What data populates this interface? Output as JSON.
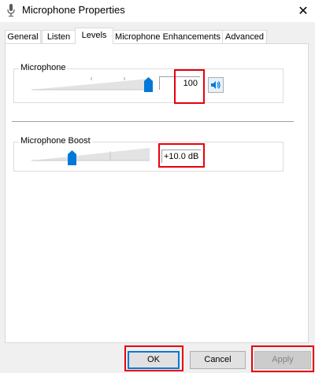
{
  "window": {
    "title": "Microphone Properties",
    "title_icon": "microphone-icon",
    "close_glyph": "✕"
  },
  "tabs": [
    {
      "label": "General",
      "active": false
    },
    {
      "label": "Listen",
      "active": false
    },
    {
      "label": "Levels",
      "active": true
    },
    {
      "label": "Microphone Enhancements",
      "active": false
    },
    {
      "label": "Advanced",
      "active": false
    }
  ],
  "levels": {
    "microphone": {
      "label": "Microphone",
      "value_text": "100",
      "level_percent": 100,
      "speaker_icon": "speaker-icon"
    },
    "boost": {
      "label": "Microphone Boost",
      "value_text": "+10.0 dB",
      "level_fraction": 0.333
    }
  },
  "buttons": {
    "ok": "OK",
    "cancel": "Cancel",
    "apply": "Apply"
  },
  "colors": {
    "accent": "#0078d7",
    "highlight": "#e8000e"
  }
}
